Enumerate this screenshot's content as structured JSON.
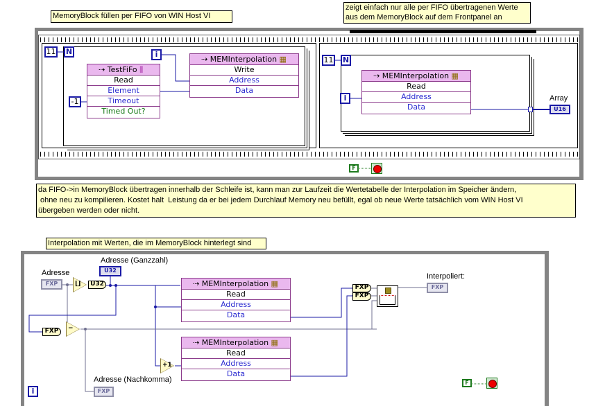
{
  "comments": {
    "top_left": "MemoryBlock füllen per FIFO von WIN Host VI",
    "top_right_1": "zeigt einfach nur alle per FIFO übertragenen Werte",
    "top_right_2": "aus dem MemoryBlock auf dem Frontpanel an",
    "middle_1": "da FIFO->in MemoryBlock übertragen innerhalb der Schleife ist, kann man zur Laufzeit die Wertetabelle der Interpolation im Speicher ändern,",
    "middle_2": " ohne neu zu kompilieren. Kostet halt  Leistung da er bei jedem Durchlauf Memory neu befüllt, egal ob neue Werte tatsächlich vom WIN Host VI",
    "middle_3": "übergeben werden oder nicht.",
    "bottom": "Interpolation mit Werten, die im MemoryBlock hinterlegt sind"
  },
  "top": {
    "frame1": {
      "count": "11",
      "n": "N",
      "i": "i",
      "timeout_const": "-1",
      "fifo": {
        "title": "TestFiFo",
        "rows": [
          "Read",
          "Element",
          "Timeout",
          "Timed Out?"
        ]
      },
      "mem": {
        "title": "MEMInterpolation",
        "rows": [
          "Write",
          "Address",
          "Data"
        ]
      }
    },
    "frame2": {
      "count": "11",
      "n": "N",
      "i": "i",
      "mem": {
        "title": "MEMInterpolation",
        "rows": [
          "Read",
          "Address",
          "Data"
        ]
      },
      "array_label": "Array",
      "array_type": "U16"
    },
    "stop_const": "F"
  },
  "bottom": {
    "adresse_label": "Adresse",
    "adresse_type": "FXP",
    "round_label": "⌊⌋",
    "u32_conv": "U32",
    "ganzzahl_label": "Adresse (Ganzzahl)",
    "ganzzahl_type": "U32",
    "fxp_conv": "FXP",
    "subtract": "−",
    "plus1": "+1",
    "nachkomma_label": "Adresse (Nachkomma)",
    "nachkomma_type": "FXP",
    "mem1": {
      "title": "MEMInterpolation",
      "rows": [
        "Read",
        "Address",
        "Data"
      ]
    },
    "mem2": {
      "title": "MEMInterpolation",
      "rows": [
        "Read",
        "Address",
        "Data"
      ]
    },
    "fxp_a": "FXP",
    "fxp_b": "FXP",
    "out_label": "Interpoliert:",
    "out_type": "FXP",
    "i": "i",
    "stop_const": "F"
  }
}
